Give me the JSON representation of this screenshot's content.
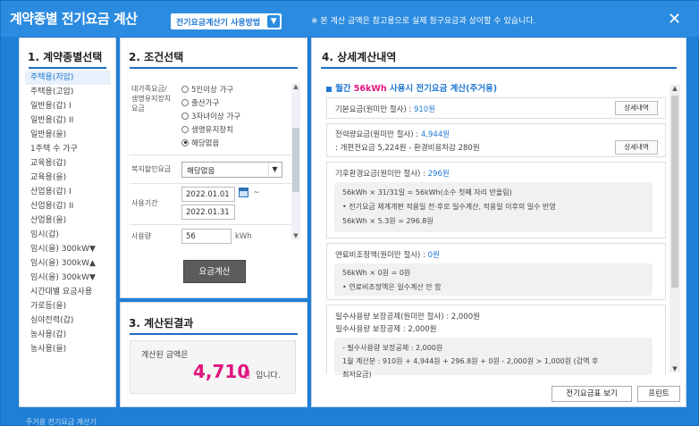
{
  "window": {
    "title": "계약종별 전기요금 계산",
    "guide_label": "전기요금계산기 사용방법",
    "notice": "※ 본 계산 금액은 참고용으로 실제 청구요금과 상이할 수 있습니다.",
    "close": "✕"
  },
  "panel1": {
    "title": "1. 계약종별선택",
    "items": [
      "주택용(저압)",
      "주택용(고압)",
      "일반용(갑) I",
      "일반용(갑) II",
      "일반용(을)",
      "1주택 수 가구",
      "교육용(갑)",
      "교육용(을)",
      "산업용(갑) I",
      "산업용(갑) II",
      "산업용(을)",
      "임시(갑)",
      "임시(을) 300kW▼",
      "임시(을) 300kW▲",
      "임시(을) 300kW▼",
      "시간대별 요금사용",
      "가로등(을)",
      "심야전력(갑)",
      "농사용(갑)",
      "농사용(을)"
    ]
  },
  "panel2": {
    "title": "2. 조건선택",
    "discount_label_1": "대가족요금/",
    "discount_label_2": "생명유지장치",
    "discount_label_3": "요금",
    "radios": [
      "5인이상 가구",
      "출산가구",
      "3자녀이상 가구",
      "생명유지장치",
      "해당없음"
    ],
    "welfare_label": "복지할인요금",
    "welfare_value": "해당없음",
    "period_label": "사용기간",
    "date_from": "2022.01.01",
    "date_to": "2022.01.31",
    "tilde": "~",
    "usage_label": "사용량",
    "usage_value": "56",
    "usage_unit": "kWh",
    "calc_button": "요금계산"
  },
  "panel3": {
    "title": "3. 계산된결과",
    "result_label": "계산된 금액은",
    "amount": "4,710",
    "won": "원",
    "suffix": "입니다."
  },
  "panel4": {
    "title": "4. 상세계산내역",
    "subtitle_pre": "월간 ",
    "subtitle_hi": "56kWh",
    "subtitle_post": " 사용시 전기요금 계산(주거용)",
    "base_label": "기본요금(원미만 절사) : ",
    "base_value": "910원",
    "detail_btn": "상세내역",
    "energy_label": "전력량요금(원미만 절사) : ",
    "energy_value": "4,944원",
    "energy_sub": ": 개편전요금 5,224원 - 환경비용차감 280원",
    "climate_label": "기후환경요금(원미만 절사) : ",
    "climate_value": "296원",
    "climate_l1": "56kWh × 31/31일 = 56kWh(소수 첫째 자리 반올림)",
    "climate_l2": "• 전기요금 체계개편 적용일 전·후로 일수계산, 적용일 이후의 일수 반영",
    "climate_l3": "56kWh × 5.3원 = 296.8원",
    "fuel_label": "연료비조정액(원미만 절사) : ",
    "fuel_value": "0원",
    "fuel_l1": "56kWh × 0원 = 0원",
    "fuel_l2": "• 연료비조정액은 일수계산 안 함",
    "min_l1": "필수사용량 보장공제(원미만 절사) : 2,000원",
    "min_l2": "필수사용량 보장공제 : 2,000원",
    "min_g1": "- 필수사용량 보장공제 : 2,000원",
    "min_g2": "1월 계산분 : 910원 + 4,944원 + 296.8원 + 0원 - 2,000원 > 1,000원 (감액 후",
    "min_g3": "최저요금)",
    "view_rates": "전기요금표 보기",
    "print": "프린트"
  },
  "bottom": {
    "text": "주거용 전기요금 계산기"
  }
}
